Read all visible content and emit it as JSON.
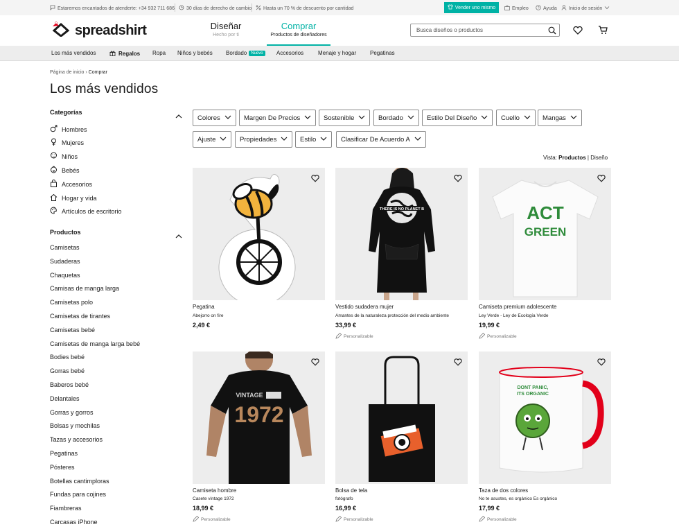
{
  "topbar": {
    "contact": "Estaremos encantados de atenderte: +34 932 711 686",
    "returns": "30 días de derecho de cambio",
    "discount": "Hasta un 70 % de descuento por cantidad",
    "sell": "Vender uno mismo",
    "jobs": "Empleo",
    "help": "Ayuda",
    "login": "Inicio de sesión"
  },
  "header": {
    "logo": "spreadshirt",
    "tab_design": {
      "label": "Diseñar",
      "sub": "Hecho por ti"
    },
    "tab_shop": {
      "label": "Comprar",
      "sub": "Productos de diseñadores"
    },
    "search_placeholder": "Busca diseños o productos",
    "accent": "#00b2a5"
  },
  "catnav": {
    "items": [
      "Los más vendidos",
      "Regalos",
      "Ropa",
      "Niños y bebés",
      "Bordado",
      "Accesorios",
      "Menaje y hogar",
      "Pegatinas"
    ],
    "badge": "Nuevo"
  },
  "breadcrumb": {
    "home": "Página de inicio",
    "current": "Comprar"
  },
  "page_title": "Los más vendidos",
  "sidebar": {
    "categories_title": "Categorías",
    "categories": [
      {
        "label": "Hombres",
        "icon": "male-icon"
      },
      {
        "label": "Mujeres",
        "icon": "female-icon"
      },
      {
        "label": "Niños",
        "icon": "child-icon"
      },
      {
        "label": "Bebés",
        "icon": "baby-icon"
      },
      {
        "label": "Accesorios",
        "icon": "bag-icon"
      },
      {
        "label": "Hogar y vida",
        "icon": "house-icon"
      },
      {
        "label": "Artículos de escritorio",
        "icon": "palette-icon"
      }
    ],
    "products_title": "Productos",
    "products": [
      "Camisetas",
      "Sudaderas",
      "Chaquetas",
      "Camisas de manga larga",
      "Camisetas polo",
      "Camisetas de tirantes",
      "Camisetas bebé",
      "Camisetas de manga larga bebé",
      "Bodies bebé",
      "Gorras bebé",
      "Baberos bebé",
      "Delantales",
      "Gorras y gorros",
      "Bolsas y mochilas",
      "Tazas y accesorios",
      "Pegatinas",
      "Pósteres",
      "Botellas cantimploras",
      "Fundas para cojines",
      "Fiambreras",
      "Carcasas iPhone"
    ]
  },
  "filters": {
    "row1": [
      "Colores",
      "Margen De Precios",
      "Sostenible",
      "Bordado",
      "Estilo Del Diseño",
      "Cuello",
      "Mangas"
    ],
    "row2": [
      "Ajuste",
      "Propiedades",
      "Estilo",
      "Clasificar De Acuerdo A"
    ]
  },
  "view": {
    "label": "Vista:",
    "products": "Productos",
    "sep": "|",
    "designs": "Diseño"
  },
  "products": [
    {
      "type": "Pegatina",
      "desc": "Abejorro on fire",
      "price": "2,49 €",
      "personalizable": ""
    },
    {
      "type": "Vestido sudadera mujer",
      "desc": "Amantes de la naturaleza protección del medio ambiente",
      "price": "33,99 €",
      "personalizable": "Personalizable"
    },
    {
      "type": "Camiseta premium adolescente",
      "desc": "Ley Verde - Ley de Ecología Verde",
      "price": "19,99 €",
      "personalizable": "Personalizable"
    },
    {
      "type": "Camiseta hombre",
      "desc": "Casete vintage 1972",
      "price": "18,99 €",
      "personalizable": "Personalizable"
    },
    {
      "type": "Bolsa de tela",
      "desc": "fotógrafo",
      "price": "16,99 €",
      "personalizable": "Personalizable"
    },
    {
      "type": "Taza de dos colores",
      "desc": "No te asustes, es orgánico Es orgánico",
      "price": "17,99 €",
      "personalizable": "Personalizable"
    }
  ],
  "artwork": {
    "hoodie_text": "THERE IS NO PLANET B",
    "tshirt_text": [
      "ACT",
      "GREEN"
    ],
    "mens_tee": [
      "VINTAGE",
      "1972"
    ],
    "mug_text": [
      "DONT PANIC,",
      "ITS ORGANIC"
    ]
  }
}
